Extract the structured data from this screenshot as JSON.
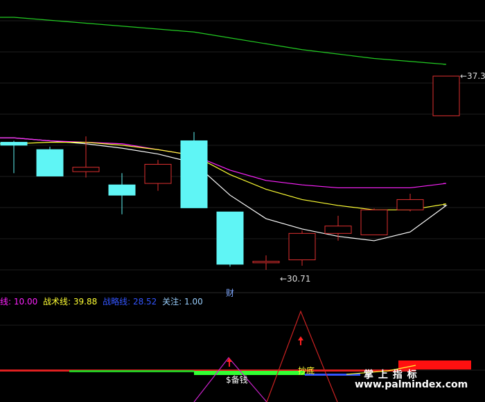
{
  "chart_data": {
    "type": "candlestick",
    "grid": true,
    "main_panel": {
      "candles": [
        {
          "open": 35.05,
          "close": 34.95,
          "high": 35.1,
          "low": 34.0,
          "color": "#5ff5f5"
        },
        {
          "open": 34.8,
          "close": 33.9,
          "high": 34.9,
          "low": 33.9,
          "color": "#5ff5f5"
        },
        {
          "open": 34.05,
          "close": 34.2,
          "high": 35.25,
          "low": 33.85,
          "color": "#e03030"
        },
        {
          "open": 33.6,
          "close": 33.25,
          "high": 34.0,
          "low": 32.6,
          "color": "#5ff5f5"
        },
        {
          "open": 33.65,
          "close": 34.3,
          "high": 34.45,
          "low": 33.4,
          "color": "#e03030"
        },
        {
          "open": 35.1,
          "close": 32.82,
          "high": 35.4,
          "low": 32.82,
          "color": "#5ff5f5"
        },
        {
          "open": 32.68,
          "close": 30.9,
          "high": 32.68,
          "low": 30.82,
          "color": "#5ff5f5"
        },
        {
          "open": 30.95,
          "close": 31.0,
          "high": 31.2,
          "low": 30.71,
          "color": "#e03030"
        },
        {
          "open": 31.05,
          "close": 31.95,
          "high": 32.05,
          "low": 30.85,
          "color": "#e03030"
        },
        {
          "open": 31.95,
          "close": 32.2,
          "high": 32.55,
          "low": 31.7,
          "color": "#e03030"
        },
        {
          "open": 31.9,
          "close": 32.75,
          "high": 32.8,
          "low": 31.9,
          "color": "#e03030"
        },
        {
          "open": 32.75,
          "close": 33.1,
          "high": 33.3,
          "low": 32.7,
          "color": "#e03030"
        },
        {
          "open": 35.95,
          "close": 37.3,
          "high": 37.3,
          "low": 35.95,
          "color": "#e03030"
        }
      ],
      "ma_lines": [
        {
          "color": "#ffffff",
          "values": [
            35.2,
            35.1,
            35.0,
            34.85,
            34.65,
            34.35,
            33.25,
            32.45,
            32.1,
            31.85,
            31.7,
            32.0,
            32.9
          ]
        },
        {
          "color": "#ff22ff",
          "values": [
            35.2,
            35.1,
            35.05,
            35.0,
            34.8,
            34.6,
            34.1,
            33.75,
            33.6,
            33.5,
            33.5,
            33.5,
            33.65
          ]
        },
        {
          "color": "#ffff33",
          "values": [
            35.0,
            35.05,
            35.05,
            34.95,
            34.8,
            34.6,
            33.95,
            33.45,
            33.1,
            32.9,
            32.75,
            32.75,
            32.95
          ]
        },
        {
          "color": "#22cc22",
          "values": [
            39.3,
            39.2,
            39.1,
            39.0,
            38.9,
            38.8,
            38.6,
            38.4,
            38.2,
            38.05,
            37.9,
            37.8,
            37.7
          ]
        }
      ],
      "annotations": [
        {
          "label": "37.30",
          "candle": 12,
          "value": 37.3
        },
        {
          "label": "30.71",
          "candle": 7,
          "value": 30.71
        },
        {
          "label": "财",
          "candle": 6,
          "value": 30.6
        }
      ]
    },
    "indicator_panel": {
      "legend": [
        {
          "label": "线: 10.00",
          "color": "#ff22ff"
        },
        {
          "label": "战术线: 39.88",
          "color": "#ffff33"
        },
        {
          "label": "战略线: 28.52",
          "color": "#3355ff"
        },
        {
          "label": "关注: 1.00",
          "color": "#9ad0ff"
        }
      ],
      "markers": [
        {
          "label": "$备钱",
          "candle": 6,
          "color": "#ffffff"
        },
        {
          "label": "抄底",
          "candle": 8,
          "color": "#ffff33"
        }
      ]
    }
  },
  "watermark": {
    "line1": "掌 上 指 标",
    "line2": "www.palmindex.com"
  }
}
